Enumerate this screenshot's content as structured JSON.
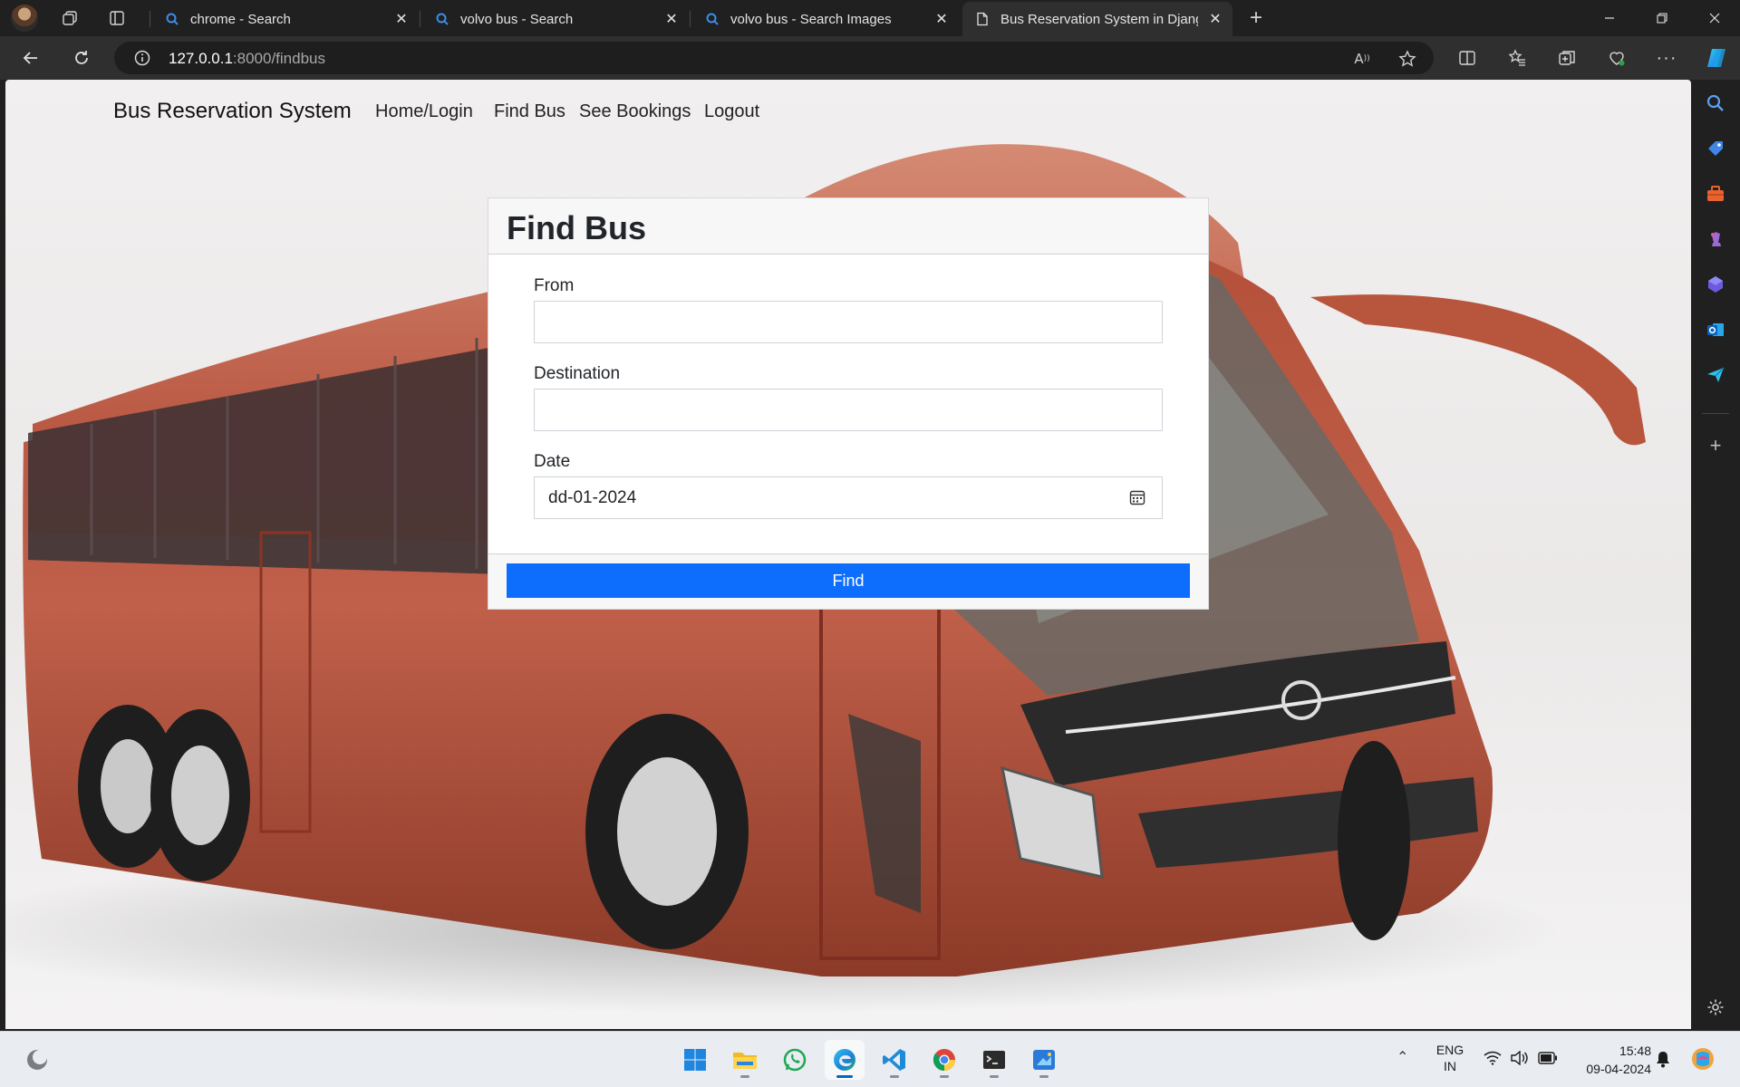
{
  "browser": {
    "tabs": [
      {
        "title": "chrome - Search",
        "icon": "search-icon"
      },
      {
        "title": "volvo bus - Search",
        "icon": "search-icon"
      },
      {
        "title": "volvo bus - Search Images",
        "icon": "search-icon"
      },
      {
        "title": "Bus Reservation System in Django",
        "icon": "page-icon",
        "active": true
      }
    ],
    "url_host": "127.0.0.1",
    "url_path": ":8000/findbus",
    "accent": "#0d6efd"
  },
  "site": {
    "brand": "Bus Reservation System",
    "nav": [
      "Home/Login",
      "Find Bus",
      "See Bookings",
      "Logout"
    ]
  },
  "form": {
    "title": "Find Bus",
    "from_label": "From",
    "from_value": "",
    "destination_label": "Destination",
    "destination_value": "",
    "date_label": "Date",
    "date_value": "dd-01-2024",
    "submit_label": "Find"
  },
  "taskbar": {
    "apps": [
      "windows-start",
      "file-explorer",
      "whatsapp",
      "edge",
      "vscode",
      "chrome",
      "terminal",
      "paint"
    ],
    "language_line1": "ENG",
    "language_line2": "IN",
    "time": "15:48",
    "date": "09-04-2024"
  }
}
